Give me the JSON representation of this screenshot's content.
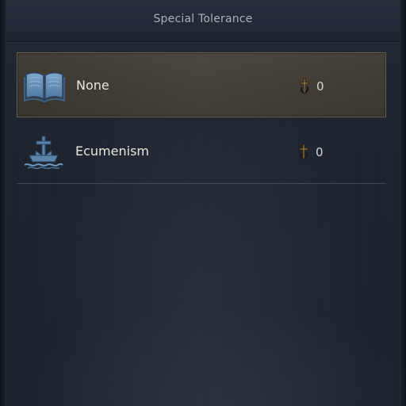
{
  "window": {
    "title": "Special Tolerance"
  },
  "options": [
    {
      "name": "None",
      "value": "0",
      "icon": "open-book-icon",
      "selected": true
    },
    {
      "name": "Ecumenism",
      "value": "0",
      "icon": "cross-ship-icon",
      "selected": false
    }
  ],
  "value_icon": "piety-icon",
  "colors": {
    "background": "#1c222c",
    "selected_row": "#433e36",
    "selected_border": "#6b6452",
    "icon_blue": "#5a84aa",
    "title_text": "#aab0b8",
    "row_text": "#e8e6e1"
  }
}
